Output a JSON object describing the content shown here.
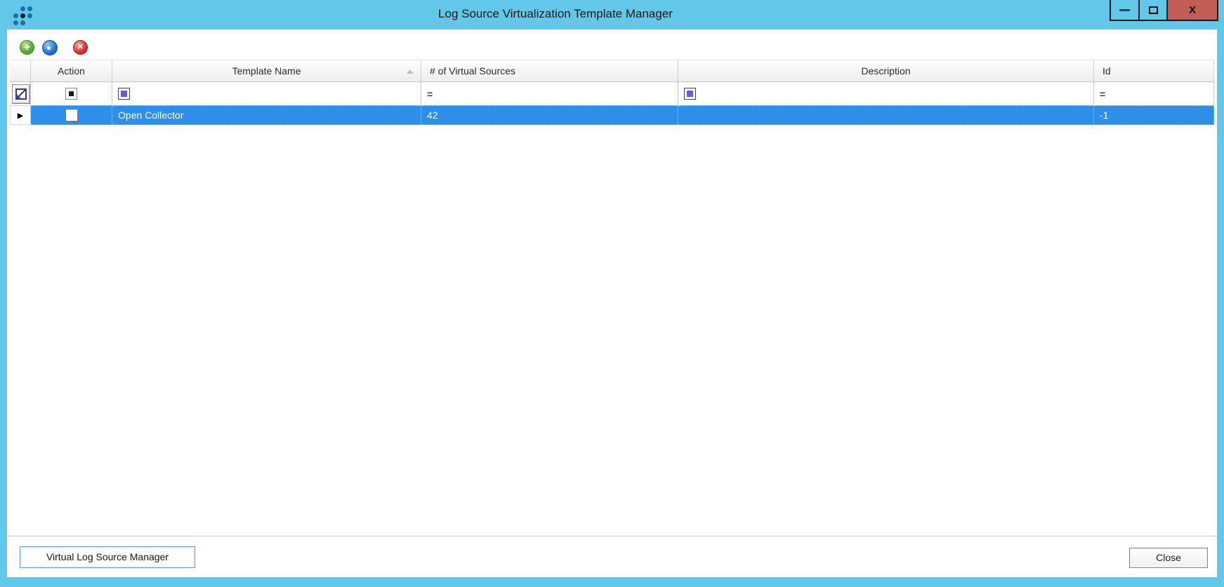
{
  "window": {
    "title": "Log Source Virtualization Template Manager",
    "close_glyph": "X"
  },
  "toolbar": {
    "add_glyph": "+",
    "delete_glyph": "✕",
    "icons": [
      {
        "name": "add-icon",
        "color": "#5aae3c"
      },
      {
        "name": "properties-icon",
        "color": "#2273cc"
      },
      {
        "name": "delete-icon",
        "color": "#d5332c"
      }
    ]
  },
  "grid": {
    "columns": [
      {
        "label": "Action"
      },
      {
        "label": "Template Name",
        "sorted": "ascending"
      },
      {
        "label": "# of Virtual Sources"
      },
      {
        "label": "Description"
      },
      {
        "label": "Id"
      }
    ],
    "filter_row": {
      "equals_glyph": "=",
      "clear_filter_icon": "clear-filter-button",
      "action_filter": "indeterminate-checkbox",
      "template_name_filter": "blue-square-checkbox",
      "description_filter": "blue-square-checkbox"
    },
    "row_indicator_glyph": "▶",
    "rows": [
      {
        "selected": true,
        "action_checked": false,
        "template_name": "Open Collector",
        "virtual_sources": "42",
        "description": "",
        "id": "-1"
      }
    ]
  },
  "footer": {
    "virtual_log_source_manager_label": "Virtual Log Source Manager",
    "close_label": "Close"
  },
  "colors": {
    "titlebar": "#62C7E8",
    "close_button": "#C25E55",
    "selection": "#2F8EEA",
    "filter_accent": "#6060D0",
    "logo_blue": "#1B6FB5",
    "logo_dark": "#0B1E33"
  }
}
